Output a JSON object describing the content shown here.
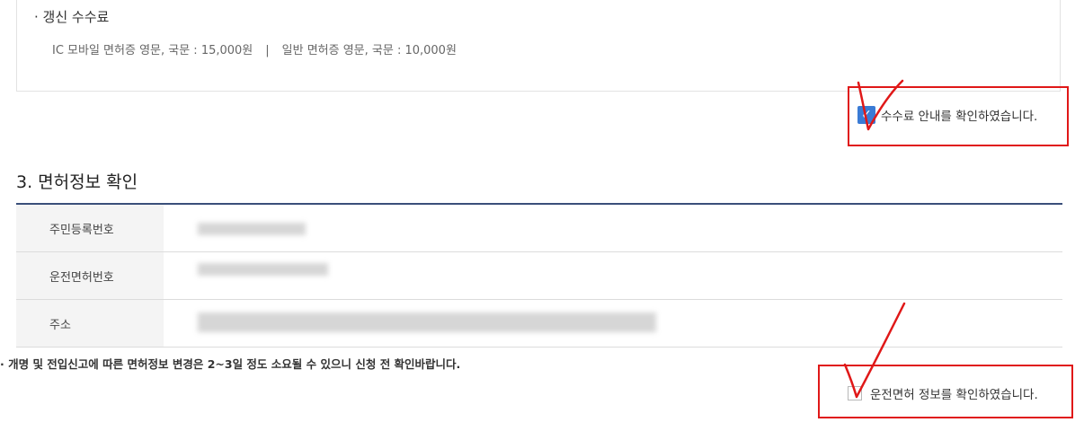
{
  "fee": {
    "title": "· 갱신 수수료",
    "ic_mobile": "IC 모바일 면허증 영문, 국문 : 15,000원",
    "separator": "|",
    "general": "일반 면허증 영문, 국문 : 10,000원"
  },
  "fee_confirm": {
    "label": "수수료 안내를 확인하였습니다.",
    "checked": true
  },
  "license_section": {
    "title": "3. 면허정보 확인",
    "rows": [
      {
        "label": "주민등록번호",
        "value": ""
      },
      {
        "label": "운전면허번호",
        "value": ""
      },
      {
        "label": "주소",
        "value": ""
      }
    ],
    "notice": "· 개명 및 전입신고에 따른 면허정보 변경은 2~3일 정도 소요될 수 있으니 신청 전 확인바랍니다."
  },
  "license_confirm": {
    "label": "운전면허 정보를 확인하였습니다.",
    "checked": false
  },
  "colors": {
    "annotation": "#e01818",
    "checkbox_checked": "#3a7bd5",
    "table_header_line": "#3a4f7a"
  },
  "icons": [
    "checkmark-icon"
  ]
}
